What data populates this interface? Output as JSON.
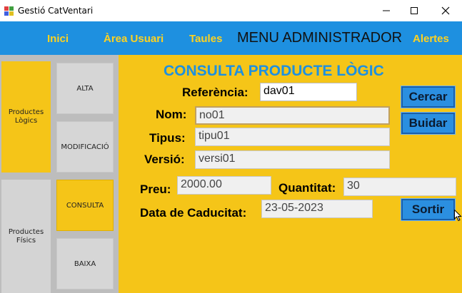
{
  "window": {
    "title": "Gestió CatVentari",
    "icon": "app-icon",
    "controls": [
      "minimize-icon",
      "maximize-icon",
      "close-icon"
    ]
  },
  "menu": {
    "inici": "Inici",
    "area_usuari": "Àrea Usuari",
    "taules": "Taules",
    "title": "MENU ADMINISTRADOR",
    "alertes": "Alertes"
  },
  "sidebar": {
    "categories": [
      {
        "label": "Productes Lògics",
        "active": true
      },
      {
        "label": "Productes Físics",
        "active": false
      }
    ],
    "actions": [
      {
        "label": "ALTA",
        "active": false
      },
      {
        "label": "MODIFICACIÓ",
        "active": false
      },
      {
        "label": "CONSULTA",
        "active": true
      },
      {
        "label": "BAIXA",
        "active": false
      }
    ]
  },
  "form": {
    "title": "CONSULTA PRODUCTE LÒGIC",
    "referencia": {
      "label": "Referència:",
      "value": "dav01"
    },
    "nom": {
      "label": "Nom:",
      "value": "no01"
    },
    "tipus": {
      "label": "Tipus:",
      "value": "tipu01"
    },
    "versio": {
      "label": "Versió:",
      "value": "versi01"
    },
    "preu": {
      "label": "Preu:",
      "value": "2000.00"
    },
    "quantitat": {
      "label": "Quantitat:",
      "value": "30"
    },
    "data_caducitat": {
      "label": "Data de Caducitat:",
      "value": "23-05-2023"
    },
    "buttons": {
      "cercar": "Cercar",
      "buidar": "Buidar",
      "sortir": "Sortir"
    }
  },
  "colors": {
    "menubar": "#1e90e0",
    "menu_text": "#ffd21f",
    "panel": "#f5c518",
    "title_blue": "#1e90e0",
    "button": "#2b8fe0"
  }
}
